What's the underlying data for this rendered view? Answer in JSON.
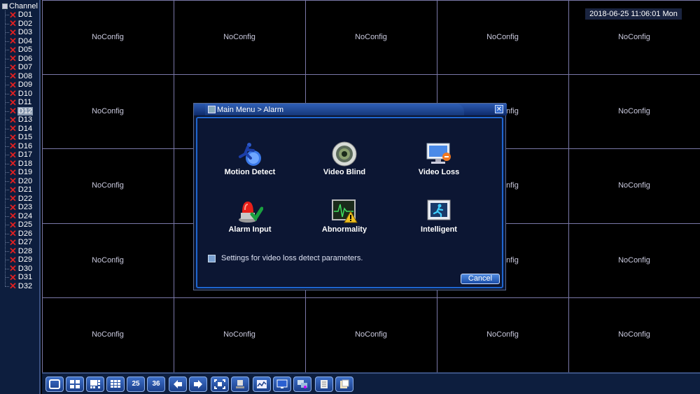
{
  "sidebar": {
    "title": "Channel",
    "channels": [
      "D01",
      "D02",
      "D03",
      "D04",
      "D05",
      "D06",
      "D07",
      "D08",
      "D09",
      "D10",
      "D11",
      "D12",
      "D13",
      "D14",
      "D15",
      "D16",
      "D17",
      "D18",
      "D19",
      "D20",
      "D21",
      "D22",
      "D23",
      "D24",
      "D25",
      "D26",
      "D27",
      "D28",
      "D29",
      "D30",
      "D31",
      "D32"
    ],
    "selected": "D12"
  },
  "grid": {
    "cell_label": "NoConfig",
    "columns": 5,
    "rows": 5
  },
  "datetime": "2018-06-25 11:06:01 Mon",
  "dialog": {
    "title": "Main Menu > Alarm",
    "items": [
      {
        "label": "Motion Detect",
        "icon": "motion-detect-icon"
      },
      {
        "label": "Video Blind",
        "icon": "video-blind-icon"
      },
      {
        "label": "Video Loss",
        "icon": "video-loss-icon"
      },
      {
        "label": "Alarm Input",
        "icon": "alarm-input-icon"
      },
      {
        "label": "Abnormality",
        "icon": "abnormality-icon"
      },
      {
        "label": "Intelligent",
        "icon": "intelligent-icon"
      }
    ],
    "hint": "Settings for video loss detect parameters.",
    "cancel_label": "Cancel"
  },
  "toolbar": {
    "buttons": [
      "single-view",
      "quad-view",
      "view-8",
      "view-9",
      "view-25",
      "view-36",
      "previous",
      "next",
      "fullscreen",
      "ptz",
      "graph",
      "display",
      "network",
      "record",
      "playback"
    ],
    "view25_label": "25",
    "view36_label": "36"
  },
  "colors": {
    "accent": "#1e66d0",
    "close_x": "#e02020"
  }
}
